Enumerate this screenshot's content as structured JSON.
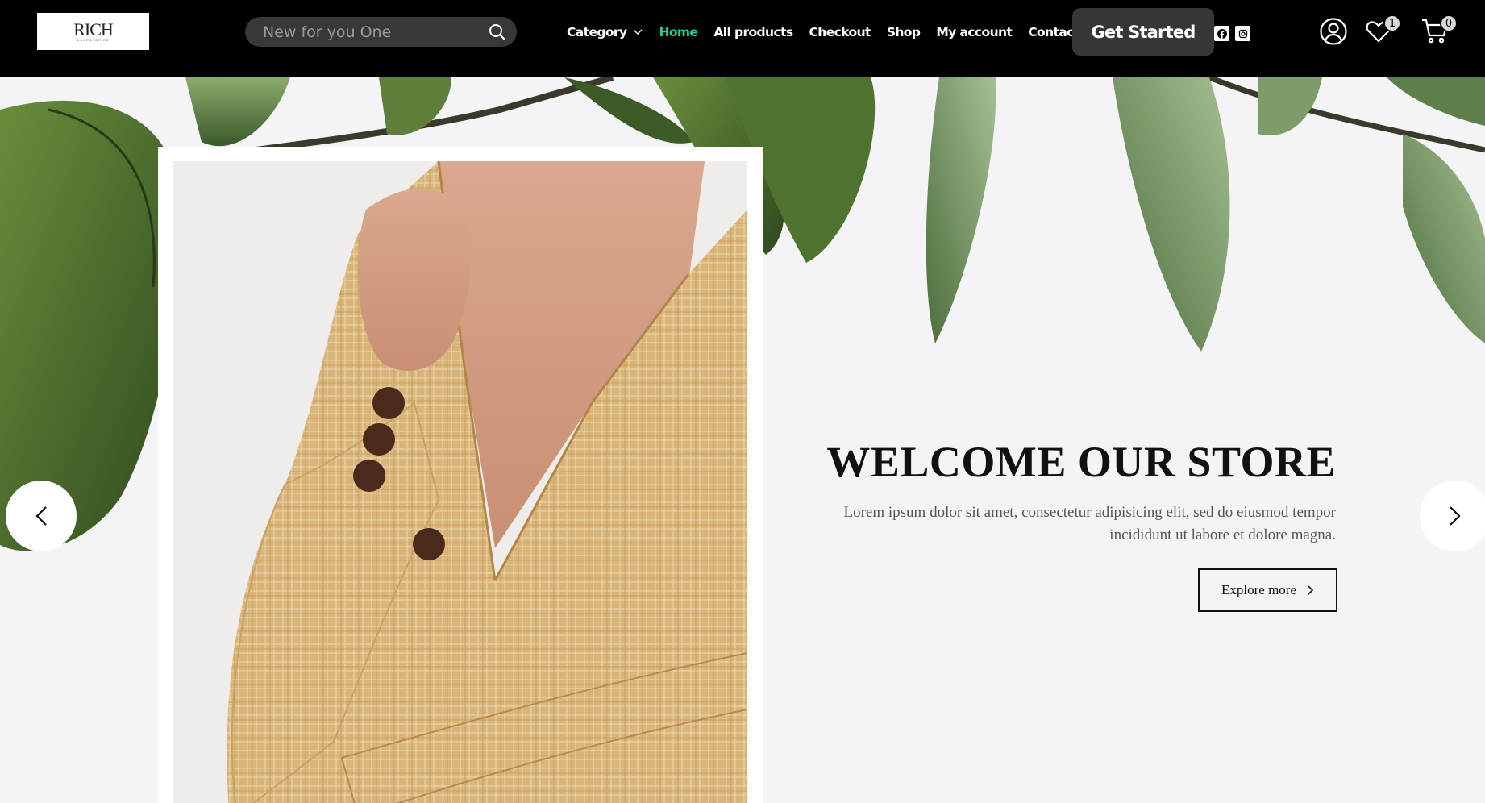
{
  "brand": {
    "logo_text": "RICH",
    "logo_sub": "ACCESSORIES"
  },
  "search": {
    "placeholder": "New for you One"
  },
  "nav": {
    "items": [
      {
        "label": "Category",
        "has_dropdown": true
      },
      {
        "label": "Home",
        "active": true
      },
      {
        "label": "All products"
      },
      {
        "label": "Checkout"
      },
      {
        "label": "Shop"
      },
      {
        "label": "My account"
      },
      {
        "label": "Contact"
      }
    ],
    "active_color": "#1ed38b"
  },
  "header": {
    "cta_label": "Get Started",
    "social": [
      "facebook-icon",
      "instagram-icon"
    ],
    "wishlist_count": "1",
    "cart_count": "0"
  },
  "hero": {
    "title": "WELCOME OUR STORE",
    "description": "Lorem ipsum dolor sit amet, consectetur adipisicing elit, sed do eiusmod tempor incididunt ut labore et dolore magna.",
    "button_label": "Explore more"
  },
  "slider": {
    "prev": "chevron-left-icon",
    "next": "chevron-right-icon"
  }
}
